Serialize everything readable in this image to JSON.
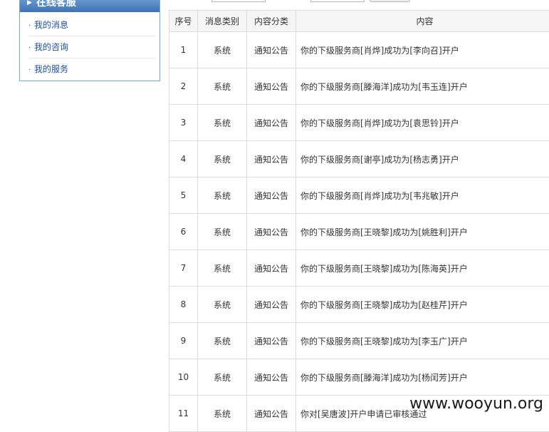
{
  "sidebar": {
    "title": "在线客服",
    "items": [
      {
        "label": "我的消息"
      },
      {
        "label": "我的咨询"
      },
      {
        "label": "我的服务"
      }
    ]
  },
  "table": {
    "headers": [
      "序号",
      "消息类别",
      "内容分类",
      "内容"
    ],
    "rows": [
      {
        "num": "1",
        "type": "系统",
        "category": "通知公告",
        "content": "你的下级服务商[肖烨]成功为[李向召]开户"
      },
      {
        "num": "2",
        "type": "系统",
        "category": "通知公告",
        "content": "你的下级服务商[滕海洋]成功为[韦玉连]开户"
      },
      {
        "num": "3",
        "type": "系统",
        "category": "通知公告",
        "content": "你的下级服务商[肖烨]成功为[袁思铃]开户"
      },
      {
        "num": "4",
        "type": "系统",
        "category": "通知公告",
        "content": "你的下级服务商[谢亭]成功为[杨志勇]开户"
      },
      {
        "num": "5",
        "type": "系统",
        "category": "通知公告",
        "content": "你的下级服务商[肖烨]成功为[韦兆敏]开户"
      },
      {
        "num": "6",
        "type": "系统",
        "category": "通知公告",
        "content": "你的下级服务商[王晓黎]成功为[姚胜利]开户"
      },
      {
        "num": "7",
        "type": "系统",
        "category": "通知公告",
        "content": "你的下级服务商[王晓黎]成功为[陈海英]开户"
      },
      {
        "num": "8",
        "type": "系统",
        "category": "通知公告",
        "content": "你的下级服务商[王晓黎]成功为[赵桂芹]开户"
      },
      {
        "num": "9",
        "type": "系统",
        "category": "通知公告",
        "content": "你的下级服务商[王晓黎]成功为[李玉广]开户"
      },
      {
        "num": "10",
        "type": "系统",
        "category": "通知公告",
        "content": "你的下级服务商[滕海洋]成功为[杨闰芳]开户"
      },
      {
        "num": "11",
        "type": "系统",
        "category": "通知公告",
        "content": "你对[吴唐波]开户申请已审核通过"
      }
    ]
  },
  "watermark": "www.wooyun.org",
  "colors": {
    "accent": "#3e73b5",
    "link": "#1f4f9e",
    "border": "#dcdcdc"
  }
}
